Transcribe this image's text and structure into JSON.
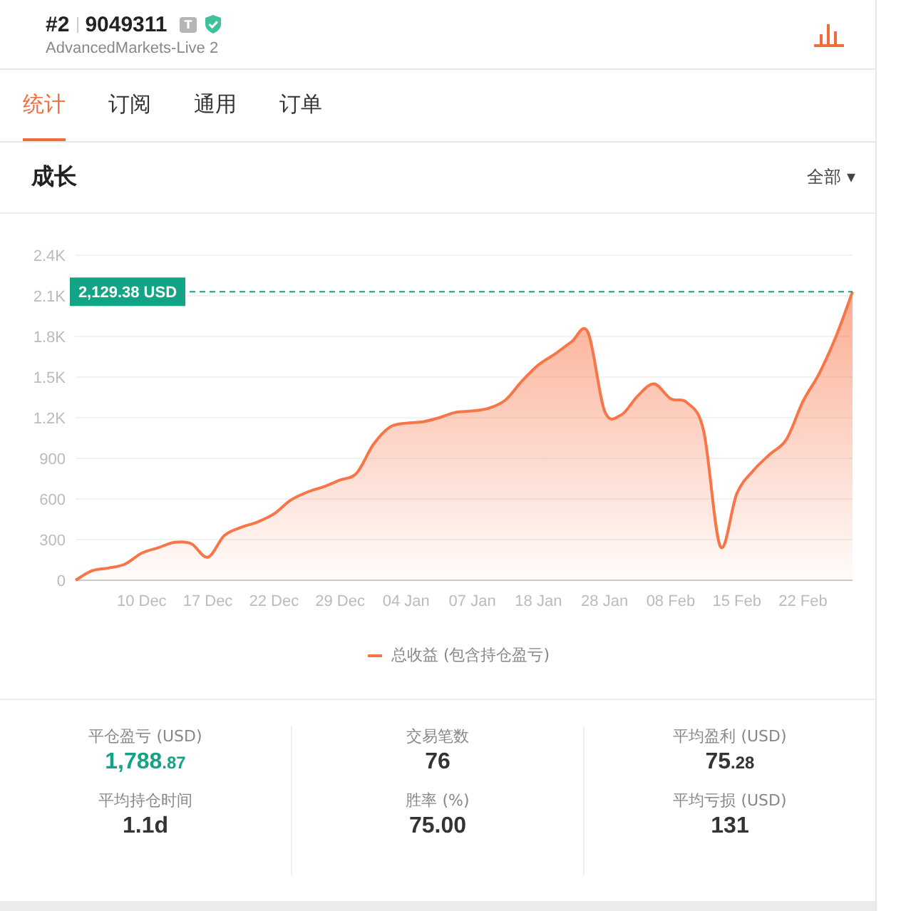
{
  "header": {
    "rank": "#2",
    "account": "9049311",
    "badge": "T",
    "verified": true,
    "server": "AdvancedMarkets-Live 2"
  },
  "tabs": [
    {
      "label": "统计",
      "selected": true
    },
    {
      "label": "订阅",
      "selected": false
    },
    {
      "label": "通用",
      "selected": false
    },
    {
      "label": "订单",
      "selected": false
    }
  ],
  "section": {
    "title": "成长",
    "filter": "全部 ▾"
  },
  "chart_data": {
    "type": "area",
    "categories": [
      null,
      null,
      null,
      null,
      "10 Dec",
      null,
      null,
      null,
      "17 Dec",
      null,
      null,
      null,
      "22 Dec",
      null,
      null,
      null,
      "29 Dec",
      null,
      null,
      null,
      "04 Jan",
      null,
      null,
      null,
      "07 Jan",
      null,
      null,
      null,
      "18 Jan",
      null,
      null,
      null,
      "28 Jan",
      null,
      null,
      null,
      "08 Feb",
      null,
      null,
      null,
      "15 Feb",
      null,
      null,
      null,
      "22 Feb",
      null,
      null,
      null
    ],
    "series": [
      {
        "name": "总收益 (包含持仓盈亏)",
        "color": "#f87548",
        "values": [
          0,
          70,
          90,
          120,
          200,
          240,
          280,
          270,
          170,
          330,
          390,
          430,
          490,
          590,
          650,
          690,
          740,
          790,
          1000,
          1130,
          1160,
          1170,
          1200,
          1240,
          1250,
          1270,
          1330,
          1470,
          1590,
          1670,
          1760,
          1830,
          1250,
          1220,
          1360,
          1450,
          1340,
          1310,
          1100,
          250,
          640,
          810,
          930,
          1040,
          1320,
          1530,
          1800,
          2130
        ]
      }
    ],
    "ylim": [
      0,
      2400
    ],
    "grid": true,
    "ref_lines": [
      {
        "axis": "y",
        "value": 2130
      }
    ],
    "yticks": [
      {
        "value": 0,
        "label": "0"
      },
      {
        "value": 300,
        "label": "300"
      },
      {
        "value": 600,
        "label": "600"
      },
      {
        "value": 900,
        "label": "900"
      },
      {
        "value": 1200,
        "label": "1.2K"
      },
      {
        "value": 1500,
        "label": "1.5K"
      },
      {
        "value": 1800,
        "label": "1.8K"
      },
      {
        "value": 2100,
        "label": "2.1K"
      },
      {
        "value": 2400,
        "label": "2.4K"
      }
    ],
    "annotations": [
      "2,129.38 USD"
    ]
  },
  "stats": [
    {
      "label": "平仓盈亏 (USD)",
      "value": "1,788",
      "fraction": ".87",
      "color": "#13a385"
    },
    {
      "label": "交易笔数",
      "value": "76",
      "color": "#333333"
    },
    {
      "label": "平均盈利 (USD)",
      "value": "75",
      "fraction": ".28",
      "color": "#333333"
    },
    {
      "label": "平均持仓时间",
      "value": "1.1d",
      "color": "#333333"
    },
    {
      "label": "胜率 (%)",
      "value": "75.00",
      "color": "#333333"
    },
    {
      "label": "平均亏损 (USD)",
      "value": "131",
      "color": "#333333"
    }
  ]
}
